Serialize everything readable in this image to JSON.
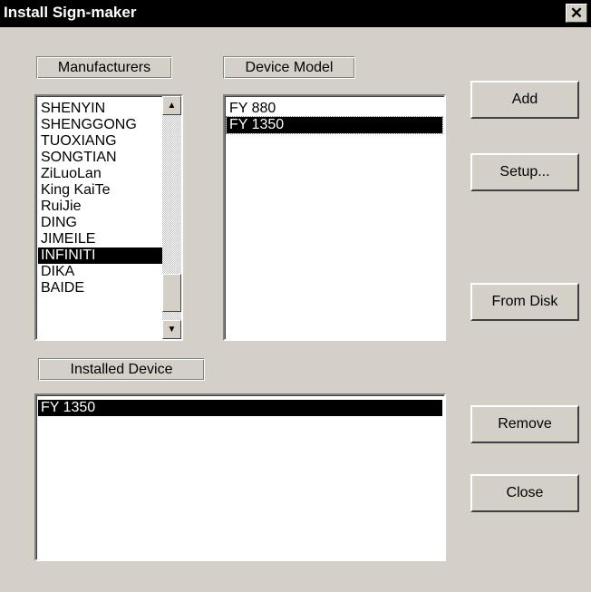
{
  "window": {
    "title": "Install Sign-maker",
    "close_glyph": "✕"
  },
  "manufacturers": {
    "label": "Manufacturers",
    "items": [
      {
        "label": "SHENYIN"
      },
      {
        "label": "SHENGGONG"
      },
      {
        "label": "TUOXIANG"
      },
      {
        "label": "SONGTIAN"
      },
      {
        "label": "ZiLuoLan"
      },
      {
        "label": "King KaiTe"
      },
      {
        "label": "RuiJie"
      },
      {
        "label": "DING"
      },
      {
        "label": "JIMEILE"
      },
      {
        "label": "INFINITI"
      },
      {
        "label": "DIKA"
      },
      {
        "label": "BAIDE"
      }
    ],
    "selected": "INFINITI",
    "scroll_up_icon": "triangle-up-icon",
    "scroll_down_icon": "triangle-down-icon"
  },
  "device_model": {
    "label": "Device Model",
    "items": [
      {
        "label": "FY 880"
      },
      {
        "label": "FY 1350"
      }
    ],
    "selected": "FY 1350"
  },
  "installed_device": {
    "label": "Installed Device",
    "items": [
      {
        "label": "FY 1350"
      }
    ],
    "selected": "FY 1350"
  },
  "buttons": {
    "add": "Add",
    "setup": "Setup...",
    "from_disk": "From Disk",
    "remove": "Remove",
    "close": "Close"
  },
  "colors": {
    "face": "#d4d0c8",
    "selection": "#000000",
    "titlebar": "#000000"
  }
}
